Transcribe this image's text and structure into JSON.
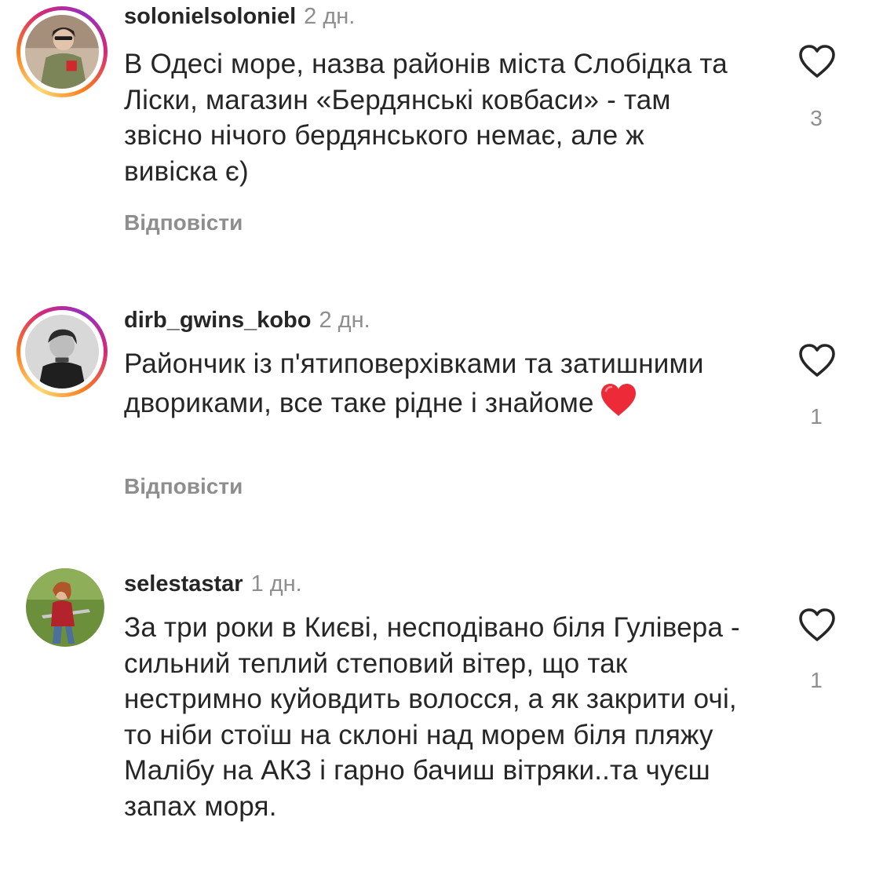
{
  "comments": [
    {
      "username": "solonielsoloniel",
      "time": "2 дн.",
      "text": "В Одесі море, назва районів міста Слобідка та Ліски, магазин «Бердянські ковбаси» - там звісно нічого бердянського немає, але ж вивіска є)",
      "reply_label": "Відповісти",
      "likes": "3",
      "has_story_ring": true
    },
    {
      "username": "dirb_gwins_kobo",
      "time": "2 дн.",
      "text": "Райончик із п'ятиповерхівками та затишними двориками, все таке рідне і знайоме",
      "emoji": "red-heart",
      "reply_label": "Відповісти",
      "likes": "1",
      "has_story_ring": true
    },
    {
      "username": "selestastar",
      "time": "1 дн.",
      "text": "За три роки в Києві, несподівано біля Гулівера - сильний теплий степовий вітер, що так нестримно куйовдить волосся, а як закрити очі, то ніби стоїш на склоні над морем біля пляжу Малібу на АКЗ і гарно бачиш вітряки..та чуєш запах моря.",
      "likes": "1",
      "has_story_ring": false
    }
  ],
  "colors": {
    "text": "#262626",
    "secondary": "#8e8e8e",
    "heart_red": "#ed2a37"
  }
}
